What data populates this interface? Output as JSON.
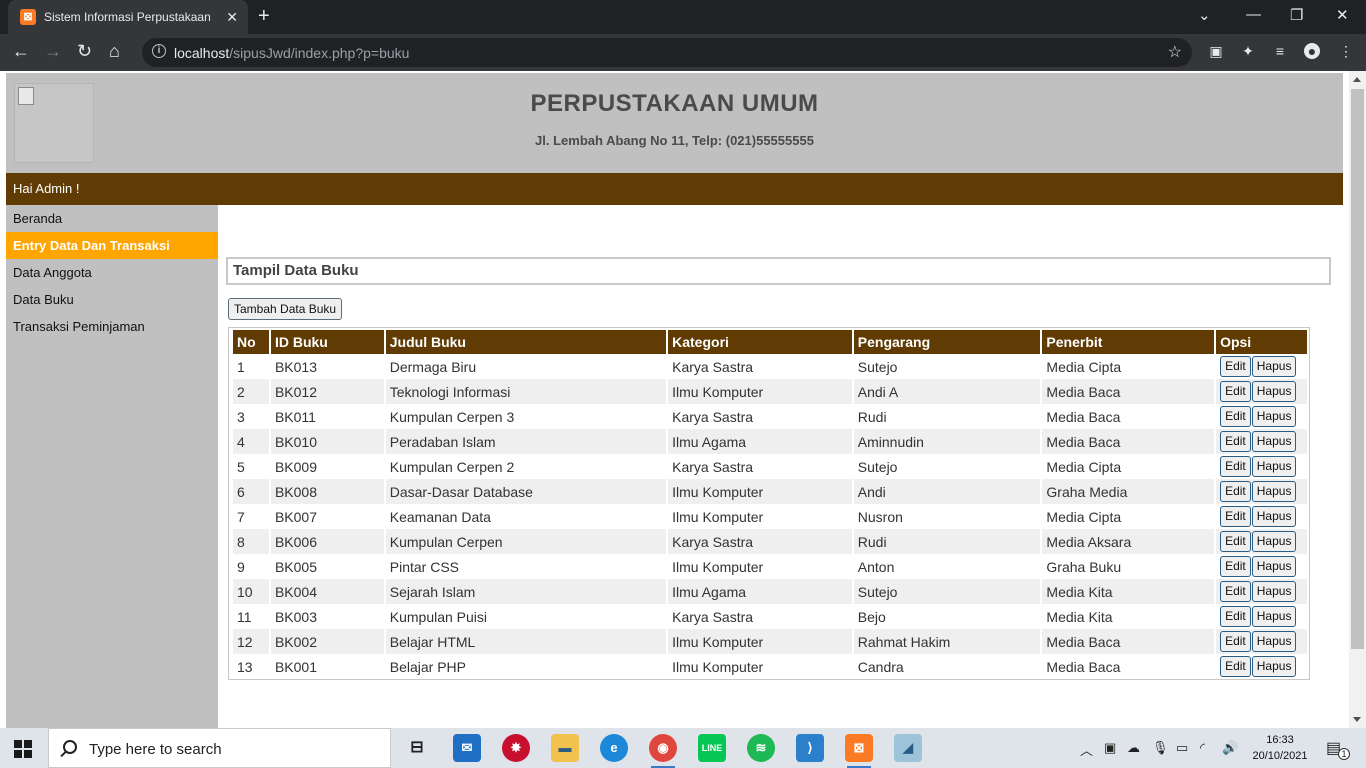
{
  "browser": {
    "tab_title": "Sistem Informasi Perpustakaan",
    "tab_favicon": "xampp-icon",
    "url_host": "localhost",
    "url_path": "/sipusJwd/index.php?p=buku"
  },
  "header": {
    "title": "PERPUSTAKAAN UMUM",
    "address": "Jl. Lembah Abang No 11, Telp: (021)55555555"
  },
  "greeting": "Hai Admin !",
  "sidebar": {
    "items": [
      {
        "label": "Beranda"
      },
      {
        "label": "Entry Data Dan Transaksi",
        "active": true
      },
      {
        "label": "Data Anggota"
      },
      {
        "label": "Data Buku"
      },
      {
        "label": "Transaksi Peminjaman"
      }
    ]
  },
  "panel": {
    "title": "Tampil Data Buku",
    "add_button": "Tambah Data Buku"
  },
  "table": {
    "headers": [
      "No",
      "ID Buku",
      "Judul Buku",
      "Kategori",
      "Pengarang",
      "Penerbit",
      "Opsi"
    ],
    "edit_label": "Edit",
    "delete_label": "Hapus",
    "rows": [
      [
        "1",
        "BK013",
        "Dermaga Biru",
        "Karya Sastra",
        "Sutejo",
        "Media Cipta"
      ],
      [
        "2",
        "BK012",
        "Teknologi Informasi",
        "Ilmu Komputer",
        "Andi A",
        "Media Baca"
      ],
      [
        "3",
        "BK011",
        "Kumpulan Cerpen 3",
        "Karya Sastra",
        "Rudi",
        "Media Baca"
      ],
      [
        "4",
        "BK010",
        "Peradaban Islam",
        "Ilmu Agama",
        "Aminnudin",
        "Media Baca"
      ],
      [
        "5",
        "BK009",
        "Kumpulan Cerpen 2",
        "Karya Sastra",
        "Sutejo",
        "Media Cipta"
      ],
      [
        "6",
        "BK008",
        "Dasar-Dasar Database",
        "Ilmu Komputer",
        "Andi",
        "Graha Media"
      ],
      [
        "7",
        "BK007",
        "Keamanan Data",
        "Ilmu Komputer",
        "Nusron",
        "Media Cipta"
      ],
      [
        "8",
        "BK006",
        "Kumpulan Cerpen",
        "Karya Sastra",
        "Rudi",
        "Media Aksara"
      ],
      [
        "9",
        "BK005",
        "Pintar CSS",
        "Ilmu Komputer",
        "Anton",
        "Graha Buku"
      ],
      [
        "10",
        "BK004",
        "Sejarah Islam",
        "Ilmu Agama",
        "Sutejo",
        "Media Kita"
      ],
      [
        "11",
        "BK003",
        "Kumpulan Puisi",
        "Karya Sastra",
        "Bejo",
        "Media Kita"
      ],
      [
        "12",
        "BK002",
        "Belajar HTML",
        "Ilmu Komputer",
        "Rahmat Hakim",
        "Media Baca"
      ],
      [
        "13",
        "BK001",
        "Belajar PHP",
        "Ilmu Komputer",
        "Candra",
        "Media Baca"
      ]
    ]
  },
  "taskbar": {
    "search_placeholder": "Type here to search",
    "time": "16:33",
    "date": "20/10/2021",
    "notification_count": "1",
    "apps": [
      "task-view",
      "mail",
      "app-red",
      "file-explorer",
      "edge",
      "chrome",
      "line",
      "spotify",
      "vscode",
      "xampp",
      "app-misc"
    ]
  },
  "colors": {
    "header_bg": "#c0c0c0",
    "accent_brown": "#603b04",
    "active_orange": "#ffa500"
  }
}
